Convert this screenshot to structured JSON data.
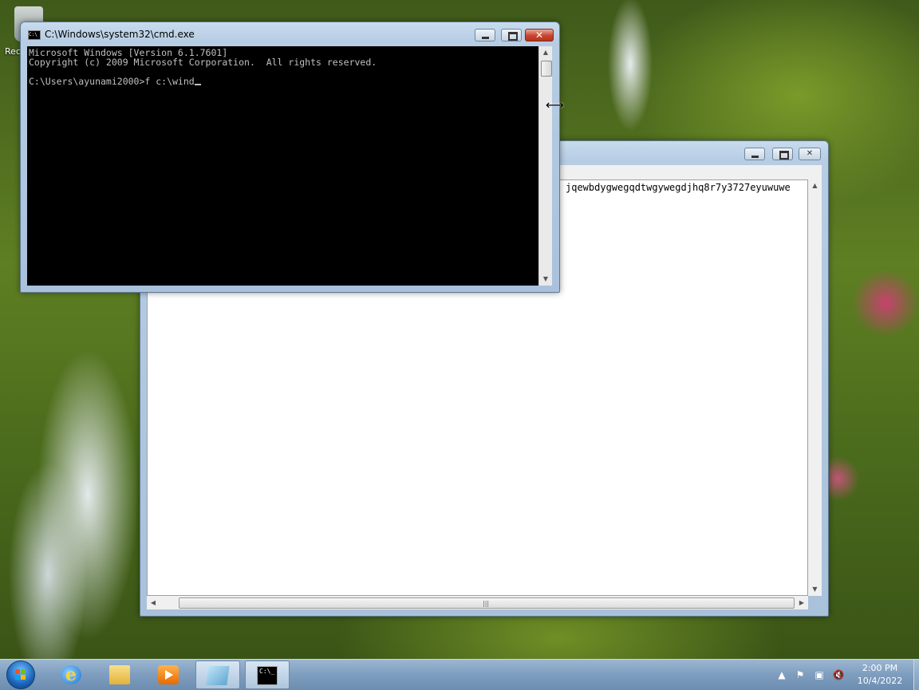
{
  "desktop": {
    "icon_label": "Rec"
  },
  "cmd_window": {
    "title": "C:\\Windows\\system32\\cmd.exe",
    "icon_text": "C:\\",
    "lines": [
      "Microsoft Windows [Version 6.1.7601]",
      "Copyright (c) 2009 Microsoft Corporation.  All rights reserved.",
      "",
      "C:\\Users\\ayunami2000>f c:\\wind"
    ],
    "min_glyph": "",
    "max_glyph": "",
    "close_glyph": "✕"
  },
  "notepad_window": {
    "text": "jqewbdygwegqdtwgywegdjhq8r7y3727eyuwuwe",
    "close_glyph": "✕"
  },
  "taskbar": {
    "clock_time": "2:00 PM",
    "clock_date": "10/4/2022",
    "cmd_icon_text": "C:\\_",
    "tray_up_arrow": "▲"
  },
  "colors": {
    "console_bg": "#000000",
    "console_fg": "#c0c0c0",
    "close_red": "#c7452e",
    "taskbar": "#7e9dbf"
  }
}
